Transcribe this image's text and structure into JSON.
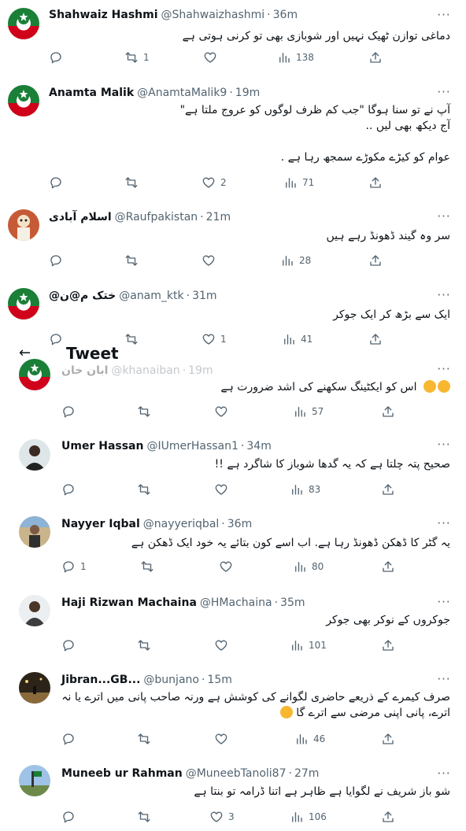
{
  "header": {
    "title": "Tweet",
    "back_icon": "arrow-left-icon"
  },
  "tweets": [
    {
      "name": "Shahwaiz Hashmi",
      "handle": "@Shahwaizhashmi",
      "time": "36m",
      "text": "دماغی توازن ٹھیک نہیں اور شوبازی بھی تو کرنی ہوتی ہے",
      "replies": "",
      "retweets": "1",
      "likes": "",
      "views": "138"
    },
    {
      "name": "Anamta Malik",
      "handle": "@AnamtaMalik9",
      "time": "19m",
      "text": "آپ نے تو سنا ہوگا \"جب کم ظرف لوگوں کو عروج ملتا ہے\"\nآج دیکھ بھی لیں ..\n\nعوام کو کیڑے مکوڑے سمجھ رہا ہے .",
      "replies": "",
      "retweets": "",
      "likes": "2",
      "views": "71"
    },
    {
      "name": "اسلام آبادی",
      "handle": "@Raufpakistan",
      "time": "21m",
      "text": "سر وہ گیند ڈھونڈ رہے ہیں",
      "replies": "",
      "retweets": "",
      "likes": "",
      "views": "28"
    },
    {
      "name": "@ختک م@ن",
      "handle": "@anam_ktk",
      "time": "31m",
      "text": "ایک سے بڑھ کر ایک جوکر",
      "replies": "",
      "retweets": "",
      "likes": "1",
      "views": "41"
    },
    {
      "name": "ابان خان",
      "handle": "@khanaiban",
      "time": "19m",
      "text": "اس کو ایکٹینگ سکھنے کی اشد ضرورت ہے",
      "replies": "",
      "retweets": "",
      "likes": "",
      "views": "57"
    },
    {
      "name": "Umer Hassan",
      "handle": "@IUmerHassan1",
      "time": "34m",
      "text": "صحیح پتہ چلتا ہے کہ یہ گدھا شوباز کا شاگرد ہے !!",
      "replies": "",
      "retweets": "",
      "likes": "",
      "views": "83"
    },
    {
      "name": "Nayyer Iqbal",
      "handle": "@nayyeriqbal",
      "time": "36m",
      "text": "یہ گٹر کا ڈھکن ڈھونڈ رہا ہے. اب اسے کون بتائے یہ خود ایک ڈھکن ہے",
      "replies": "1",
      "retweets": "",
      "likes": "",
      "views": "80"
    },
    {
      "name": "Haji Rizwan Machaina",
      "handle": "@HMachaina",
      "time": "35m",
      "text": "جوکروں کے نوکر بھی جوکر",
      "replies": "",
      "retweets": "",
      "likes": "",
      "views": "101"
    },
    {
      "name": "Jibran...GB...",
      "handle": "@bunjano",
      "time": "15m",
      "text": "صرف کیمرے کے ذریعے حاضری لگوانے کی کوشش ہے ورنہ صاحب پانی میں اترے یا نہ\nاترے، پانی اپنی مرضی سے اترے گا",
      "replies": "",
      "retweets": "",
      "likes": "",
      "views": "46"
    },
    {
      "name": "Muneeb ur Rahman",
      "handle": "@MuneebTanoli87",
      "time": "27m",
      "text": "شو باز شریف نے لگوایا ہے ظاہر ہے اتنا ڈرامہ تو بنتا ہے",
      "replies": "",
      "retweets": "",
      "likes": "3",
      "views": "106"
    }
  ],
  "icons": {
    "reply": "reply-icon",
    "retweet": "retweet-icon",
    "like": "heart-icon",
    "views": "views-chart-icon",
    "share": "share-icon",
    "more": "more-options-icon"
  },
  "colors": {
    "pti_green": "#1a7f37",
    "pti_red": "#d0021b",
    "secondary_text": "#536471",
    "emoji_yellow": "#f7b731"
  }
}
